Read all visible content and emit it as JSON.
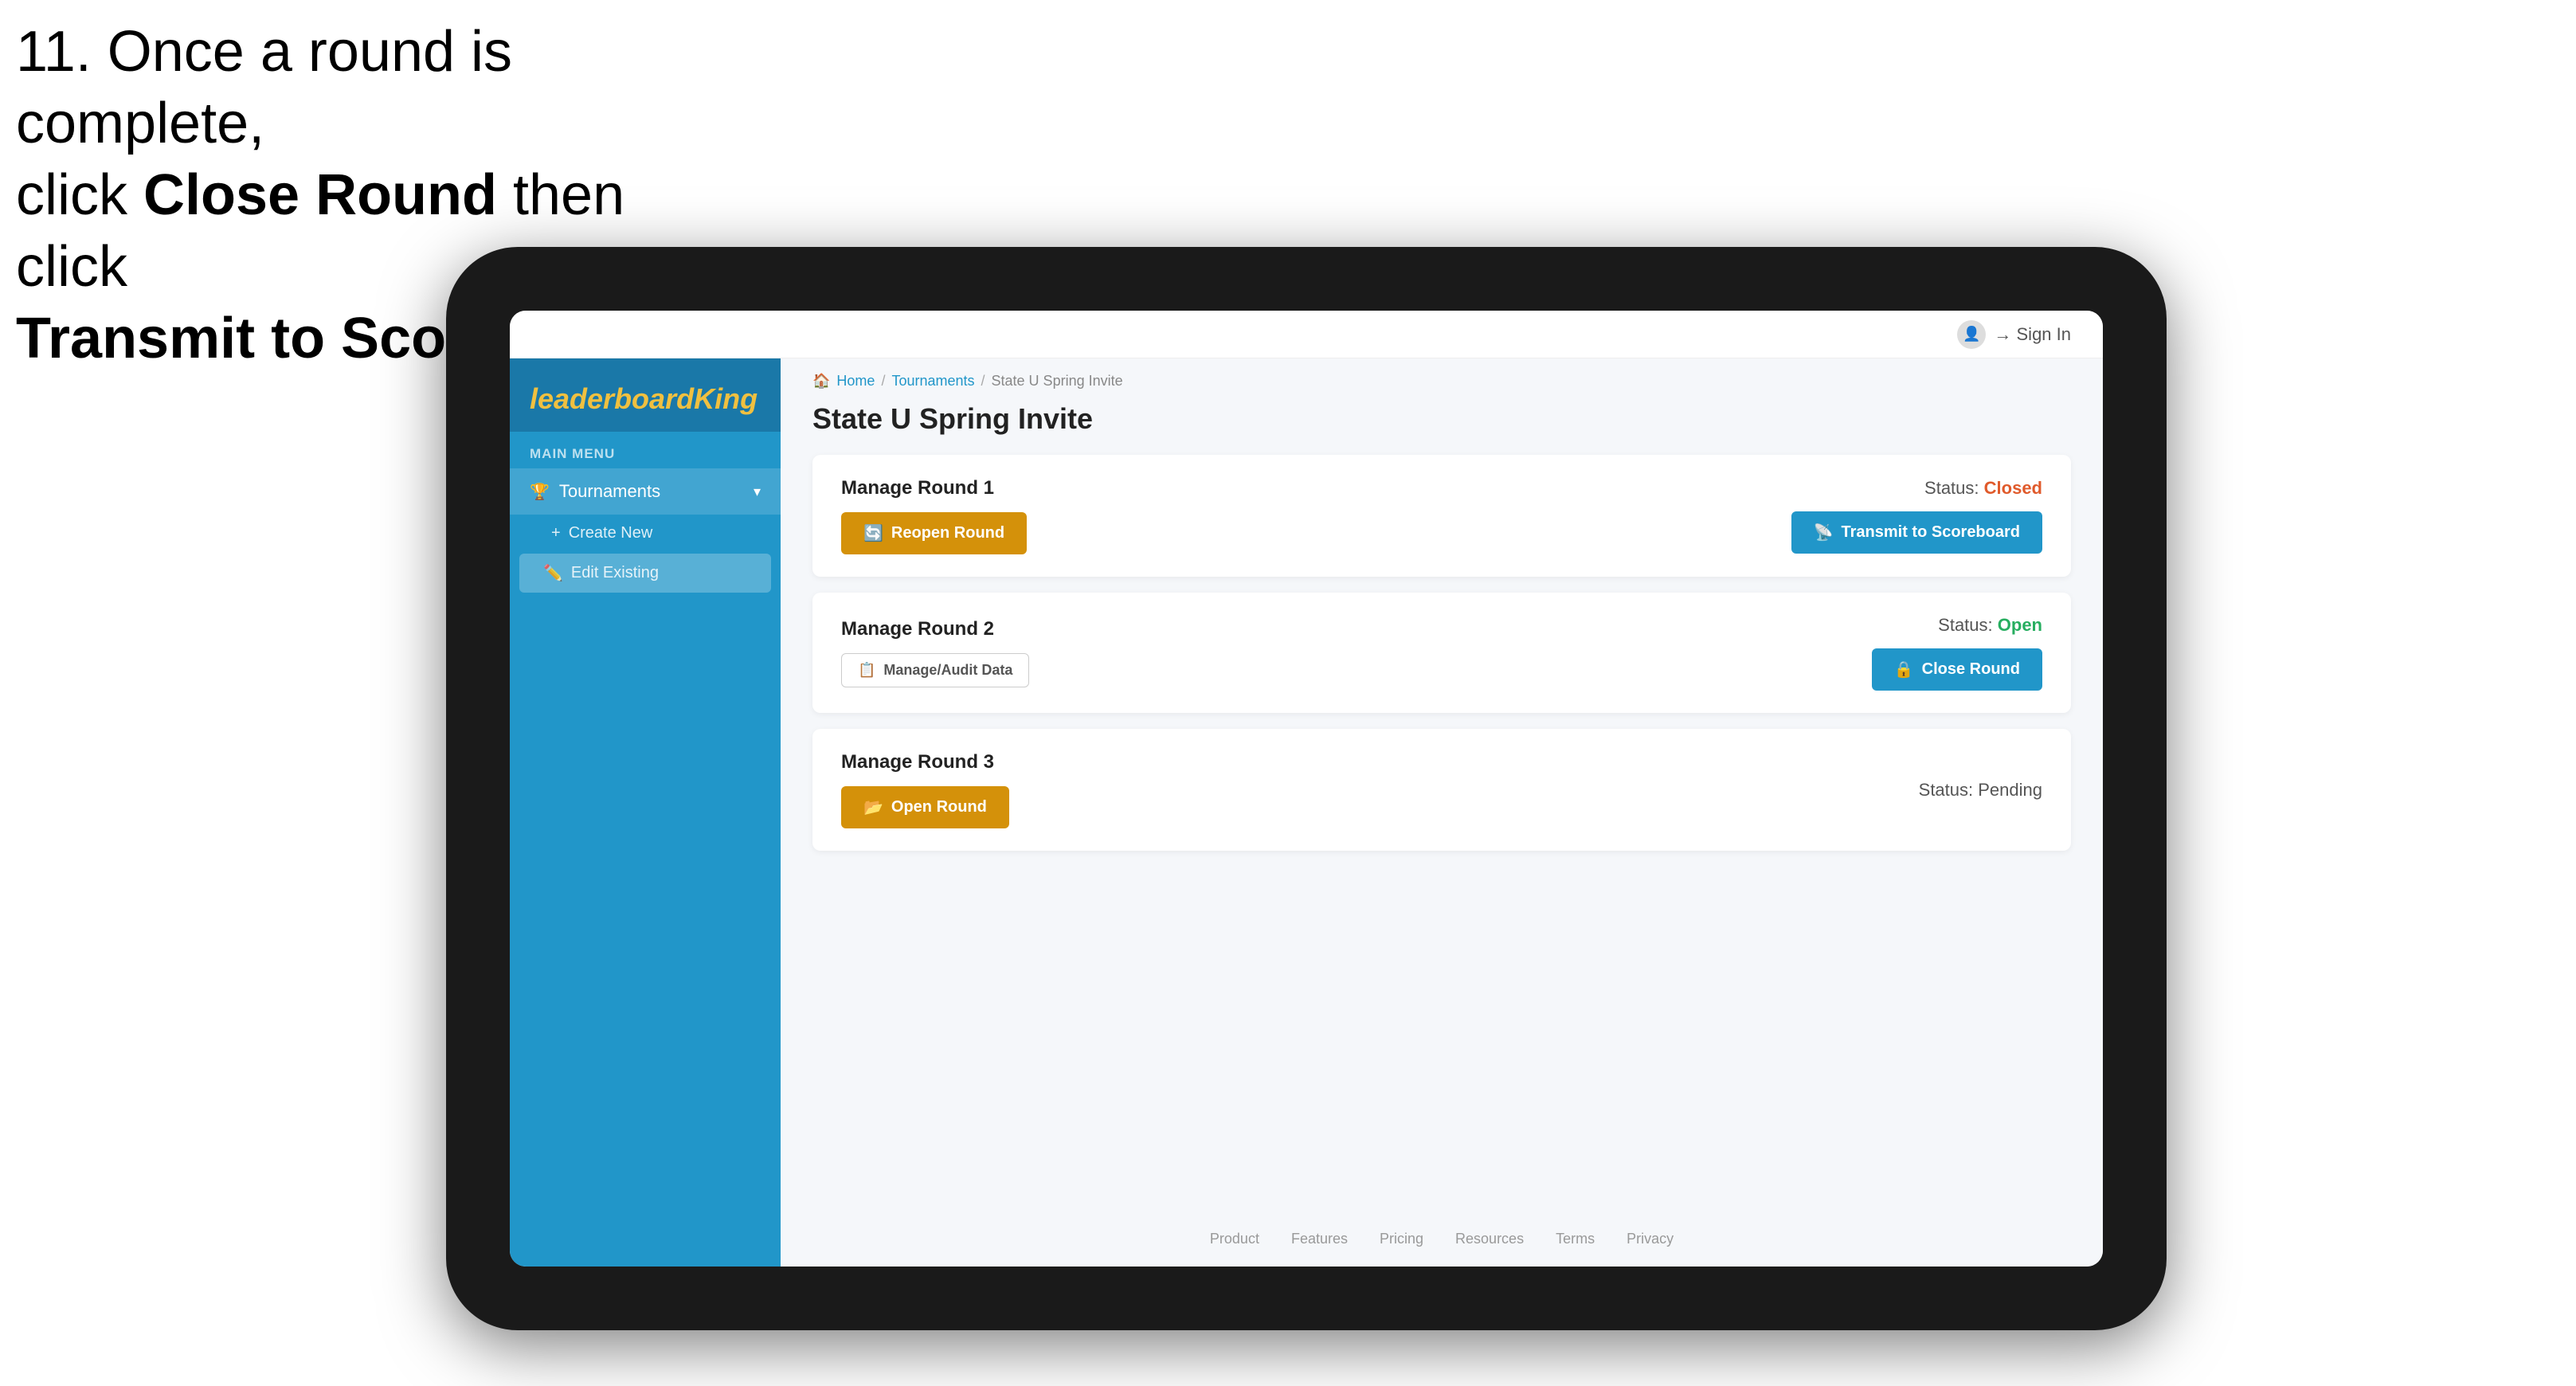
{
  "instruction": {
    "line1": "11. Once a round is complete,",
    "line2_prefix": "click ",
    "line2_bold": "Close Round",
    "line2_suffix": " then click",
    "line3_bold": "Transmit to Scoreboard."
  },
  "topbar": {
    "signin_label": "Sign In"
  },
  "sidebar": {
    "logo_text": "leaderboard",
    "logo_bold": "King",
    "menu_label": "MAIN MENU",
    "items": [
      {
        "label": "Tournaments",
        "icon": "🏆",
        "has_chevron": true,
        "subitems": [
          {
            "label": "Create New",
            "icon": "+"
          },
          {
            "label": "Edit Existing",
            "icon": "✏️",
            "selected": true
          }
        ]
      }
    ]
  },
  "breadcrumb": {
    "home": "Home",
    "sep1": "/",
    "tournaments": "Tournaments",
    "sep2": "/",
    "current": "State U Spring Invite"
  },
  "page_title": "State U Spring Invite",
  "rounds": [
    {
      "id": "round1",
      "title": "Manage Round 1",
      "status_label": "Status:",
      "status_value": "Closed",
      "status_class": "status-closed",
      "primary_button": {
        "label": "Reopen Round",
        "icon": "🔄",
        "style": "btn-gold"
      },
      "secondary_button": {
        "label": "Transmit to Scoreboard",
        "icon": "📡",
        "style": "btn-blue"
      }
    },
    {
      "id": "round2",
      "title": "Manage Round 2",
      "status_label": "Status:",
      "status_value": "Open",
      "status_class": "status-open",
      "primary_button": {
        "label": "Manage/Audit Data",
        "icon": "📋",
        "style": "btn-outline"
      },
      "secondary_button": {
        "label": "Close Round",
        "icon": "🔒",
        "style": "btn-blue"
      }
    },
    {
      "id": "round3",
      "title": "Manage Round 3",
      "status_label": "Status:",
      "status_value": "Pending",
      "status_class": "status-pending",
      "primary_button": {
        "label": "Open Round",
        "icon": "📂",
        "style": "btn-gold"
      },
      "secondary_button": null
    }
  ],
  "footer": {
    "links": [
      "Product",
      "Features",
      "Pricing",
      "Resources",
      "Terms",
      "Privacy"
    ]
  }
}
